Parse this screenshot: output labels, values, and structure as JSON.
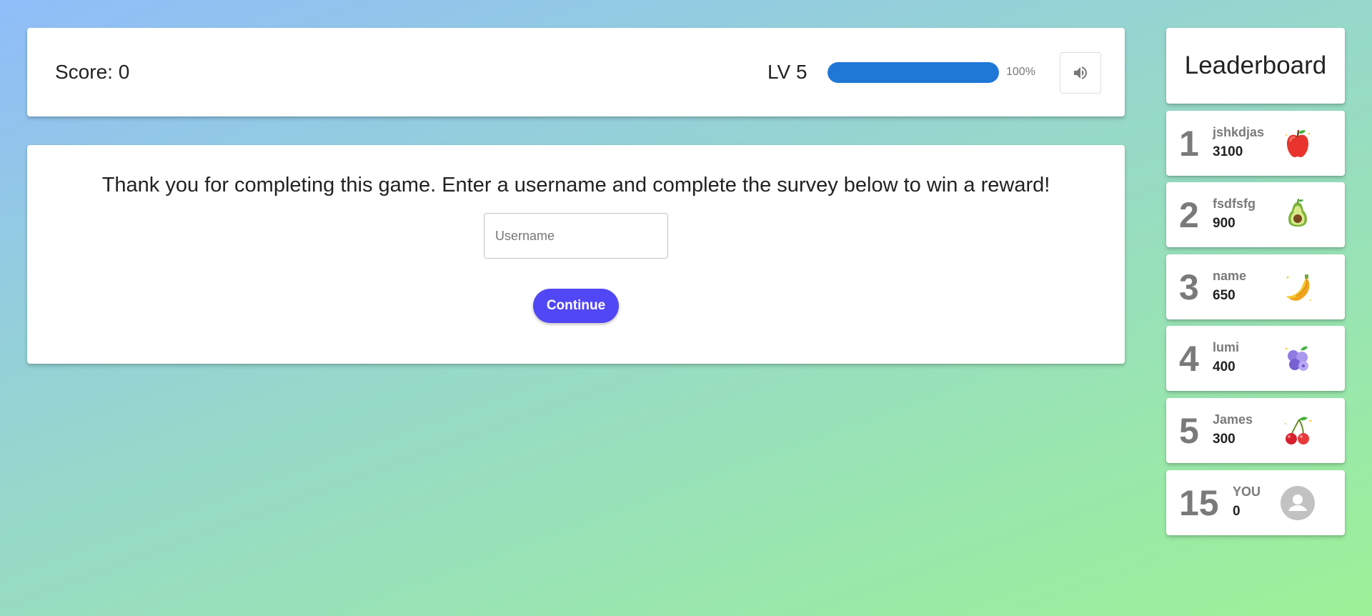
{
  "header": {
    "score_text": "Score: 0",
    "level_text": "LV 5",
    "progress_fraction": 1.0,
    "progress_text": "100%",
    "sound_icon": "volume-up-icon"
  },
  "survey": {
    "message": "Thank you for completing this game. Enter a username and complete the survey below to win a reward!",
    "username_placeholder": "Username",
    "username_value": "",
    "continue_label": "Continue"
  },
  "leaderboard": {
    "title": "Leaderboard",
    "entries": [
      {
        "rank": "1",
        "name": "jshkdjas",
        "score": "3100",
        "icon": "apple-icon"
      },
      {
        "rank": "2",
        "name": "fsdfsfg",
        "score": "900",
        "icon": "avocado-icon"
      },
      {
        "rank": "3",
        "name": "name",
        "score": "650",
        "icon": "banana-icon"
      },
      {
        "rank": "4",
        "name": "lumi",
        "score": "400",
        "icon": "blueberries-icon"
      },
      {
        "rank": "5",
        "name": "James",
        "score": "300",
        "icon": "cherries-icon"
      }
    ],
    "you": {
      "rank": "15",
      "name": "YOU",
      "score": "0",
      "icon": "user-avatar-icon"
    }
  },
  "colors": {
    "accent": "#5147f5",
    "progress": "#1f77d6",
    "rank_gray": "#7a7a7a"
  }
}
